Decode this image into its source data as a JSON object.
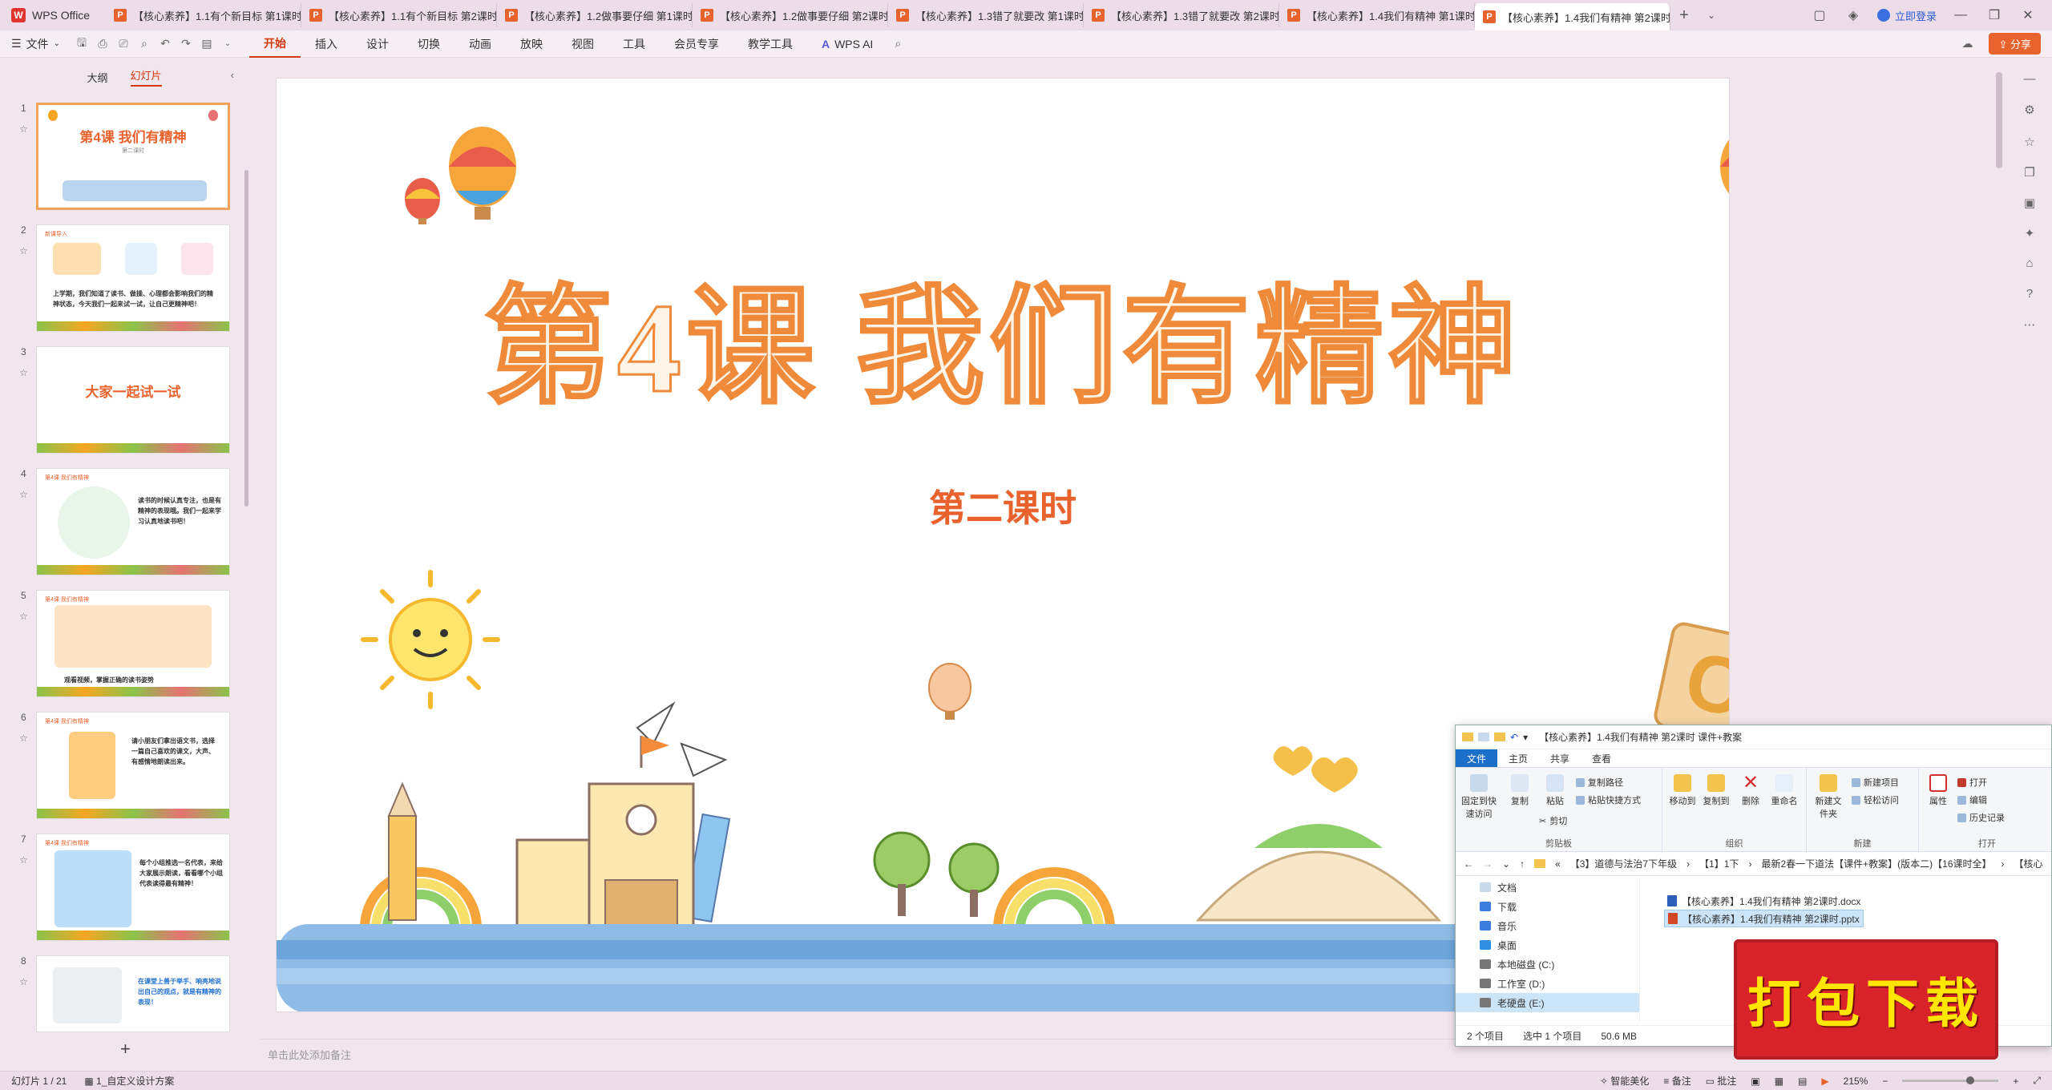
{
  "tabbar": {
    "app_name": "WPS Office",
    "tabs": [
      {
        "label": "【核心素养】1.1有个新目标 第1课时",
        "active": false
      },
      {
        "label": "【核心素养】1.1有个新目标 第2课时",
        "active": false
      },
      {
        "label": "【核心素养】1.2做事要仔细 第1课时",
        "active": false
      },
      {
        "label": "【核心素养】1.2做事要仔细 第2课时",
        "active": false
      },
      {
        "label": "【核心素养】1.3错了就要改 第1课时",
        "active": false
      },
      {
        "label": "【核心素养】1.3错了就要改 第2课时",
        "active": false
      },
      {
        "label": "【核心素养】1.4我们有精神 第1课时",
        "active": false
      },
      {
        "label": "【核心素养】1.4我们有精神 第2课时",
        "active": true
      }
    ],
    "login_label": "立即登录"
  },
  "menubar": {
    "file_label": "文件",
    "items": [
      "开始",
      "插入",
      "设计",
      "切换",
      "动画",
      "放映",
      "视图",
      "工具",
      "会员专享",
      "教学工具"
    ],
    "active_item": "开始",
    "ai_label": "WPS AI",
    "share_label": "分享"
  },
  "left_panel": {
    "tabs": [
      "大纲",
      "幻灯片"
    ],
    "active_tab": "幻灯片",
    "slides": [
      {
        "num": "1",
        "title": "第4课 我们有精神",
        "sub": "第二课时"
      },
      {
        "num": "2",
        "tag": "新课导入",
        "text": "上学期，我们知道了读书、做操、心理都会影响我们的精神状态，今天我们一起来试一试，让自己更精神吧！"
      },
      {
        "num": "3",
        "title": "大家一起试一试"
      },
      {
        "num": "4",
        "tag": "第4课 我们有精神",
        "text": "读书的时候认真专注，也是有精神的表现哦。我们一起来学习认真地读书吧！"
      },
      {
        "num": "5",
        "tag": "第4课 我们有精神",
        "text": "观看视频，掌握正确的读书姿势"
      },
      {
        "num": "6",
        "tag": "第4课 我们有精神",
        "text": "请小朋友们拿出语文书，选择一篇自己喜欢的课文，大声、有感情地朗读出来。"
      },
      {
        "num": "7",
        "tag": "第4课 我们有精神",
        "text": "每个小组推选一名代表，来给大家展示朗读，看看哪个小组代表读得最有精神！"
      },
      {
        "num": "8",
        "text": "在课堂上善于举手、响亮地说出自己的观点，就是有精神的表现！"
      }
    ]
  },
  "slide": {
    "title": "第4课  我们有精神",
    "subtitle": "第二课时",
    "notes_placeholder": "单击此处添加备注"
  },
  "statusbar": {
    "slide_indicator": "幻灯片 1 / 21",
    "theme": "1_自定义设计方案",
    "smart_beautify": "智能美化",
    "notes": "备注",
    "comments": "批注",
    "zoom": "215%"
  },
  "explorer": {
    "title": "【核心素养】1.4我们有精神 第2课时 课件+教案",
    "tabs": [
      "文件",
      "主页",
      "共享",
      "查看"
    ],
    "active_tab": "文件",
    "ribbon": {
      "clipboard": {
        "pin": "固定到快速访问",
        "copy": "复制",
        "paste": "粘贴",
        "copy_path": "复制路径",
        "paste_shortcut": "粘贴快捷方式",
        "cut": "剪切",
        "group": "剪贴板"
      },
      "organize": {
        "move_to": "移动到",
        "copy_to": "复制到",
        "delete": "删除",
        "rename": "重命名",
        "group": "组织"
      },
      "new": {
        "new_folder": "新建文件夹",
        "new_item": "新建项目",
        "easy_access": "轻松访问",
        "group": "新建"
      },
      "open": {
        "properties": "属性",
        "open": "打开",
        "edit": "编辑",
        "history": "历史记录",
        "group": "打开"
      }
    },
    "address": [
      "«",
      "【3】道德与法治7下年级",
      "【1】1下",
      "最新2春一下道法【课件+教案】(版本二)【16课时全】",
      "【核心"
    ],
    "nav": [
      {
        "label": "文档",
        "icon": "document-icon"
      },
      {
        "label": "下载",
        "icon": "download-icon"
      },
      {
        "label": "音乐",
        "icon": "music-icon"
      },
      {
        "label": "桌面",
        "icon": "desktop-icon"
      },
      {
        "label": "本地磁盘 (C:)",
        "icon": "drive-icon"
      },
      {
        "label": "工作室 (D:)",
        "icon": "drive-icon"
      },
      {
        "label": "老硬盘 (E:)",
        "icon": "drive-icon",
        "selected": true
      }
    ],
    "files": [
      {
        "name": "【核心素养】1.4我们有精神 第2课时.docx",
        "type": "docx",
        "selected": false
      },
      {
        "name": "【核心素养】1.4我们有精神 第2课时.pptx",
        "type": "pptx",
        "selected": true
      }
    ],
    "status": {
      "count": "2 个项目",
      "selected": "选中 1 个项目",
      "size": "50.6 MB"
    }
  },
  "stamp": {
    "text": "打包下载"
  },
  "colors": {
    "accent": "#d4380d",
    "title_orange": "#ef8a3a",
    "stamp_red": "#d8232a",
    "stamp_text": "#ffe600"
  }
}
